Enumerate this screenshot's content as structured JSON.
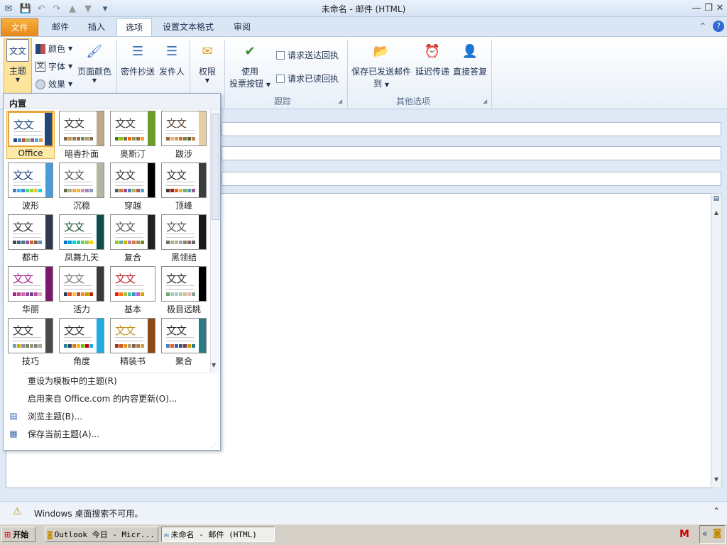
{
  "window": {
    "title": "未命名 - 邮件 (HTML)",
    "controls": [
      "minimize-icon",
      "restore-icon",
      "close-icon"
    ]
  },
  "tabs": [
    {
      "label": "文件",
      "kind": "file"
    },
    {
      "label": "邮件"
    },
    {
      "label": "插入"
    },
    {
      "label": "选项",
      "active": true
    },
    {
      "label": "设置文本格式"
    },
    {
      "label": "审阅"
    }
  ],
  "ribbon": {
    "theme": {
      "main": "主题",
      "colors": "颜色",
      "fonts": "字体",
      "effects": "效果",
      "page_color": "页面颜色"
    },
    "show_fields": {
      "bcc": "密件抄送",
      "from": "发件人"
    },
    "permission": "权限",
    "tracking": {
      "voting_l1": "使用",
      "voting_l2": "投票按钮",
      "request_delivery": "请求送达回执",
      "request_read": "请求已读回执",
      "group": "跟踪"
    },
    "more": {
      "save_sent_l1": "保存已发送邮件",
      "save_sent_l2": "到",
      "delay": "延迟传递",
      "direct": "直接答复",
      "group": "其他选项"
    }
  },
  "gallery": {
    "heading": "内置",
    "themes": [
      {
        "name": "Office",
        "colors": [
          "#1f497d",
          "#4f81bd",
          "#c0504d",
          "#9bbb59",
          "#8064a2",
          "#4bacc6",
          "#f79646"
        ],
        "bar": "#1f497d",
        "text_color": "#1f497d",
        "selected": true
      },
      {
        "name": "暗香扑面",
        "colors": [
          "#7f6a4f",
          "#c09a4b",
          "#8f7e5f",
          "#9a6b3f",
          "#6d8b6b",
          "#b59a6b",
          "#8b6d55"
        ],
        "bar": "#bfa98a",
        "text_color": "#333333"
      },
      {
        "name": "奥斯汀",
        "colors": [
          "#3e7c17",
          "#94c600",
          "#71685a",
          "#ff6700",
          "#909465",
          "#956b43",
          "#fea022"
        ],
        "bar": "#6a9b2b",
        "text_color": "#333333"
      },
      {
        "name": "跋涉",
        "colors": [
          "#8c6b42",
          "#e5b26b",
          "#c6a44e",
          "#c96d3b",
          "#6c8b3b",
          "#6b5b3b",
          "#b58a4a"
        ],
        "bar": "#e7cfa1",
        "text_color": "#5a3f2a"
      },
      {
        "name": "波形",
        "colors": [
          "#4a7dc7",
          "#31b6fd",
          "#4584d3",
          "#5bd078",
          "#a5d028",
          "#f5c040",
          "#05e0db"
        ],
        "bar": "#4a9cd6",
        "text_color": "#1f3f7a"
      },
      {
        "name": "沉稳",
        "colors": [
          "#636b46",
          "#a5b592",
          "#f3a447",
          "#e7bc29",
          "#d092a7",
          "#9c85c0",
          "#809ec2"
        ],
        "bar": "#b5b5a0",
        "text_color": "#555555"
      },
      {
        "name": "穿越",
        "colors": [
          "#5a5a5a",
          "#e47422",
          "#8b4fa5",
          "#4f81bd",
          "#9bbb59",
          "#c0504d",
          "#4bacc6"
        ],
        "bar": "#000000",
        "text_color": "#333333"
      },
      {
        "name": "顶峰",
        "colors": [
          "#3e3e3e",
          "#b01513",
          "#ea6312",
          "#e6b729",
          "#6aac90",
          "#5f9c9d",
          "#9e5e9b"
        ],
        "bar": "#3d3d3d",
        "text_color": "#333333"
      },
      {
        "name": "都市",
        "colors": [
          "#424456",
          "#53548a",
          "#438086",
          "#a04da3",
          "#c4652d",
          "#8b5d3d",
          "#5c92b5"
        ],
        "bar": "#2f3a4f",
        "text_color": "#333333"
      },
      {
        "name": "凤舞九天",
        "colors": [
          "#0f6fc6",
          "#009dd9",
          "#0bd0d9",
          "#10cf9b",
          "#7cca62",
          "#a5c249",
          "#ffcc00"
        ],
        "bar": "#0f4c4c",
        "text_color": "#1e5a3a"
      },
      {
        "name": "复合",
        "colors": [
          "#98c723",
          "#59b0b9",
          "#deae00",
          "#b77bb4",
          "#e0773c",
          "#a98d63",
          "#6b8e23"
        ],
        "bar": "#222222",
        "text_color": "#555555"
      },
      {
        "name": "黑领结",
        "colors": [
          "#6f6f74",
          "#a7b789",
          "#beae98",
          "#92a9b9",
          "#9c8265",
          "#8d6974",
          "#666666"
        ],
        "bar": "#1a1a1a",
        "text_color": "#555555"
      },
      {
        "name": "华丽",
        "colors": [
          "#a5228d",
          "#c7409c",
          "#d46aa9",
          "#8e4a9e",
          "#6f3c8f",
          "#b44f9e",
          "#e1a4c8"
        ],
        "bar": "#7a1a6a",
        "text_color": "#a5228d"
      },
      {
        "name": "活力",
        "colors": [
          "#2f3c5a",
          "#e84c22",
          "#ffbd47",
          "#b64926",
          "#ff8427",
          "#cc9900",
          "#b22600"
        ],
        "bar": "#3b3b3b",
        "text_color": "#777777"
      },
      {
        "name": "基本",
        "colors": [
          "#f81b02",
          "#fc7715",
          "#afbf41",
          "#50c49f",
          "#3b95c4",
          "#b560d4",
          "#e0a000"
        ],
        "bar": "#ffffff",
        "text_color": "#c0202b"
      },
      {
        "name": "极目远眺",
        "colors": [
          "#72a376",
          "#b0ccb0",
          "#a8cdd7",
          "#c0beaf",
          "#cec597",
          "#e8b7b7",
          "#8aa18a"
        ],
        "bar": "#000000",
        "text_color": "#333333"
      },
      {
        "name": "技巧",
        "colors": [
          "#6ea0b0",
          "#ccaf0a",
          "#8d89a4",
          "#748560",
          "#9e9273",
          "#7e848d",
          "#b0a090"
        ],
        "bar": "#4a4a4a",
        "text_color": "#333333"
      },
      {
        "name": "角度",
        "colors": [
          "#2c7c9f",
          "#244a58",
          "#e2751d",
          "#ffb400",
          "#7eb606",
          "#c00000",
          "#1cade4"
        ],
        "bar": "#1cade4",
        "text_color": "#333333"
      },
      {
        "name": "精装书",
        "colors": [
          "#a5300f",
          "#d55816",
          "#e19825",
          "#b19c7d",
          "#7f5f52",
          "#b27d49",
          "#c8a04a"
        ],
        "bar": "#8a4a1a",
        "text_color": "#c09020"
      },
      {
        "name": "聚合",
        "colors": [
          "#4a7dc7",
          "#eb641b",
          "#39639d",
          "#474b78",
          "#7d3c4a",
          "#cc9900",
          "#2a7b88"
        ],
        "bar": "#2a7b88",
        "text_color": "#333333"
      }
    ],
    "menu": [
      {
        "label": "重设为模板中的主题(R)",
        "icon": ""
      },
      {
        "label": "启用来自 Office.com 的内容更新(O)...",
        "icon": ""
      },
      {
        "label": "浏览主题(B)...",
        "icon": "browse-themes-icon"
      },
      {
        "label": "保存当前主题(A)...",
        "icon": "save-theme-icon"
      }
    ]
  },
  "statusbar": {
    "message": "Windows 桌面搜索不可用。"
  },
  "taskbar": {
    "start": "开始",
    "tasks": [
      "Outlook 今日 - Micr...",
      "未命名 - 邮件 (HTML)"
    ]
  }
}
